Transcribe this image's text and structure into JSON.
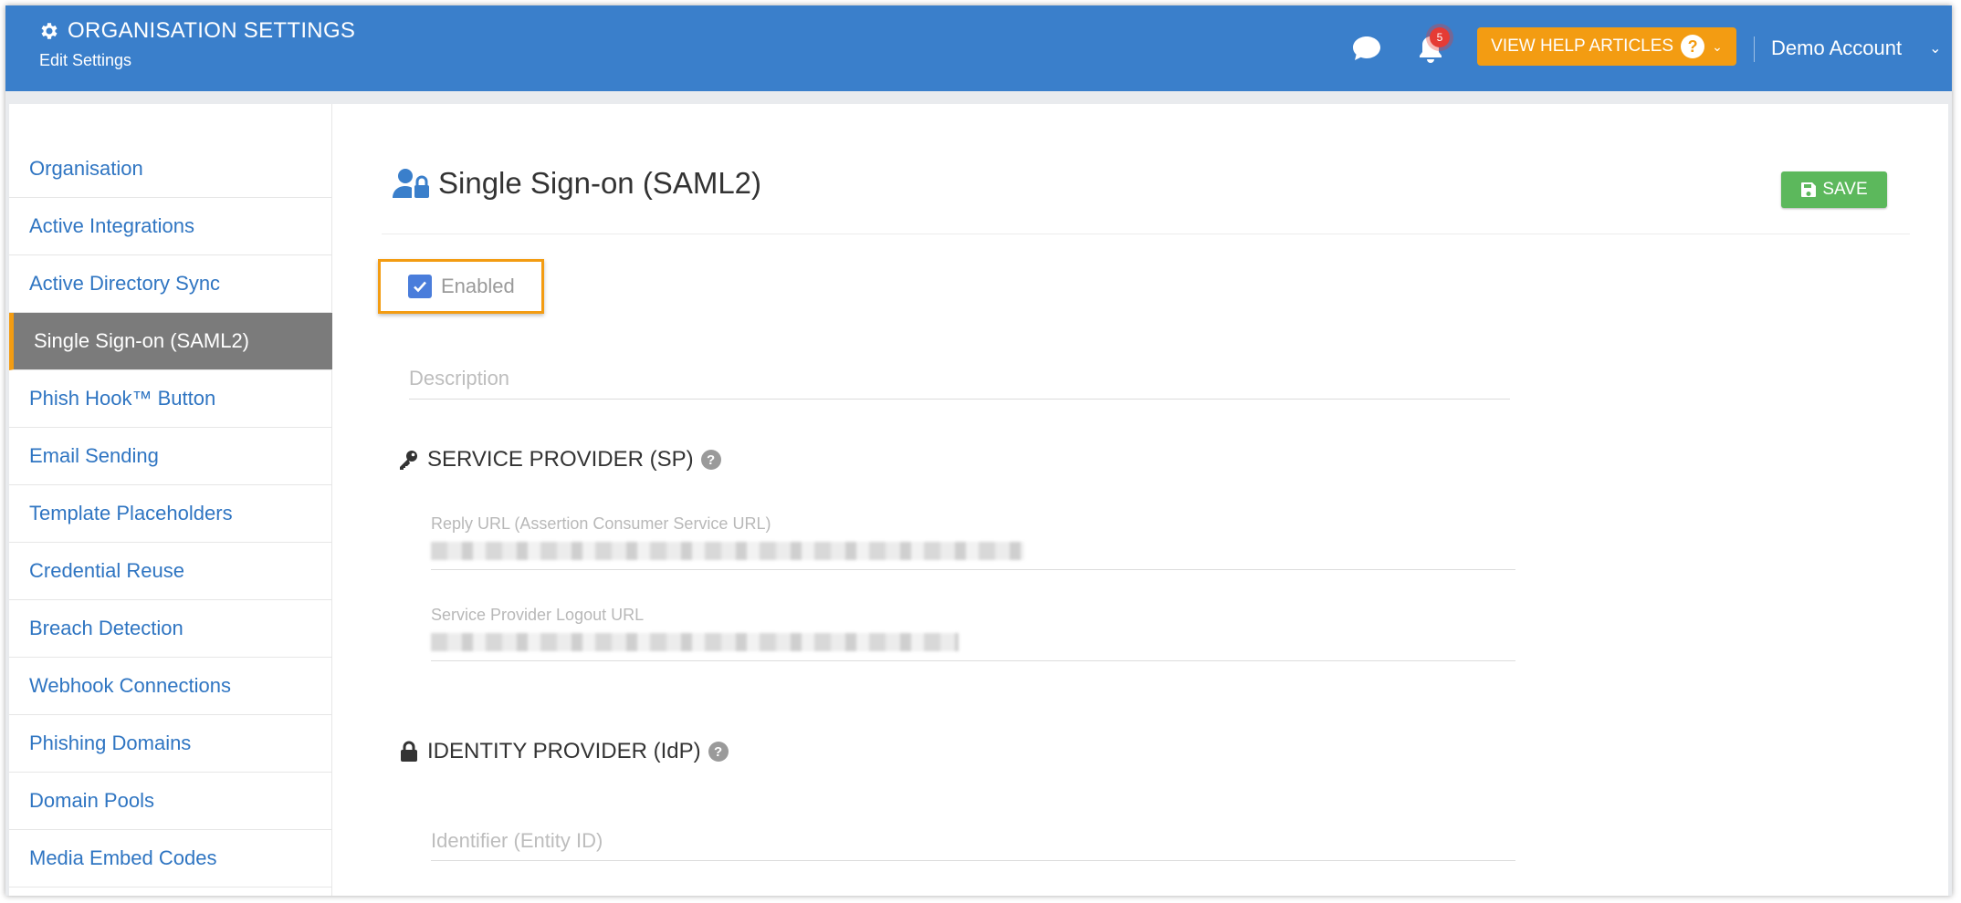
{
  "header": {
    "title": "ORGANISATION SETTINGS",
    "subtitle": "Edit Settings",
    "notification_count": "5",
    "help_button_label": "VIEW HELP ARTICLES",
    "account_name": "Demo Account"
  },
  "sidebar": {
    "items": [
      {
        "label": "Organisation"
      },
      {
        "label": "Active Integrations"
      },
      {
        "label": "Active Directory Sync"
      },
      {
        "label": "Single Sign-on (SAML2)",
        "active": true
      },
      {
        "label": "Phish Hook™ Button"
      },
      {
        "label": "Email Sending"
      },
      {
        "label": "Template Placeholders"
      },
      {
        "label": "Credential Reuse"
      },
      {
        "label": "Breach Detection"
      },
      {
        "label": "Webhook Connections"
      },
      {
        "label": "Phishing Domains"
      },
      {
        "label": "Domain Pools"
      },
      {
        "label": "Media Embed Codes"
      }
    ]
  },
  "main": {
    "title": "Single Sign-on (SAML2)",
    "save_label": "SAVE",
    "enabled_label": "Enabled",
    "enabled_checked": true,
    "description_placeholder": "Description",
    "sp_section_title": "SERVICE PROVIDER (SP)",
    "reply_url_label": "Reply URL (Assertion Consumer Service URL)",
    "logout_url_label": "Service Provider Logout URL",
    "idp_section_title": "IDENTITY PROVIDER (IdP)",
    "entity_id_placeholder": "Identifier (Entity ID)"
  },
  "colors": {
    "header_bg": "#3a7fcb",
    "accent_orange": "#f39c12",
    "save_green": "#5cb85c",
    "link_blue": "#2f75c2",
    "active_item_bg": "#7b7b7b",
    "badge_red": "#e53b35"
  },
  "icons": {
    "header": "gear-icon",
    "chat": "chat-bubble-icon",
    "notifications": "bell-icon",
    "help": "question-circle-icon",
    "page_title": "user-lock-icon",
    "save": "floppy-disk-icon",
    "sp_section": "key-icon",
    "idp_section": "lock-icon"
  }
}
